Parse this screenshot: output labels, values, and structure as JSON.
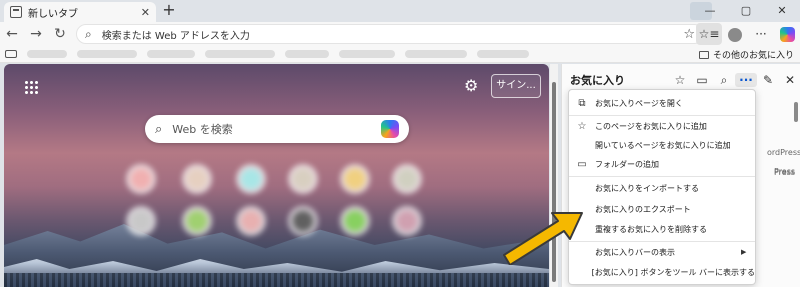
{
  "tab": {
    "title": "新しいタブ",
    "close": "✕",
    "new": "+"
  },
  "window": {
    "minimize": "—",
    "maximize": "▢",
    "close": "✕"
  },
  "address": {
    "placeholder": "検索または Web アドレスを入力"
  },
  "favorites_bar": {
    "other": "その他のお気に入り"
  },
  "newtab": {
    "signin": "サイン...",
    "search_placeholder": "Web を検索",
    "tiles": [
      {
        "color": "#f0b0b0"
      },
      {
        "color": "#e6d0c0"
      },
      {
        "color": "#a8e6e6"
      },
      {
        "color": "#d8cfc0"
      },
      {
        "color": "#f0d080"
      },
      {
        "color": "#d0d0c0"
      },
      {
        "color": "#c8c8c8"
      },
      {
        "color": "#a0d070"
      },
      {
        "color": "#e8b0b0"
      },
      {
        "color": "#606060"
      },
      {
        "color": "#88d060"
      },
      {
        "color": "#d0a0b0"
      }
    ]
  },
  "panel": {
    "title": "お気に入り",
    "bg_text": [
      "ordPress",
      "Press",
      "Press"
    ]
  },
  "menu": {
    "items": [
      {
        "label": "お気に入りページを開く",
        "icon": "open-external-icon",
        "glyph": "⧉"
      },
      {
        "label": "このページをお気に入りに追加",
        "icon": "star-add-icon",
        "glyph": "☆"
      },
      {
        "label": "開いているページをお気に入りに追加",
        "icon": "",
        "glyph": ""
      },
      {
        "label": "フォルダーの追加",
        "icon": "folder-add-icon",
        "glyph": "▭"
      },
      {
        "label": "お気に入りをインポートする",
        "icon": "",
        "glyph": ""
      },
      {
        "label": "お気に入りのエクスポート",
        "icon": "",
        "glyph": ""
      },
      {
        "label": "重複するお気に入りを削除する",
        "icon": "",
        "glyph": ""
      },
      {
        "label": "お気に入りバーの表示",
        "icon": "",
        "glyph": ""
      },
      {
        "label": "[お気に入り] ボタンをツール バーに表示する",
        "icon": "",
        "glyph": ""
      }
    ]
  },
  "colors": {
    "arrow": "#f5b800",
    "accent": "#0b57d0"
  }
}
